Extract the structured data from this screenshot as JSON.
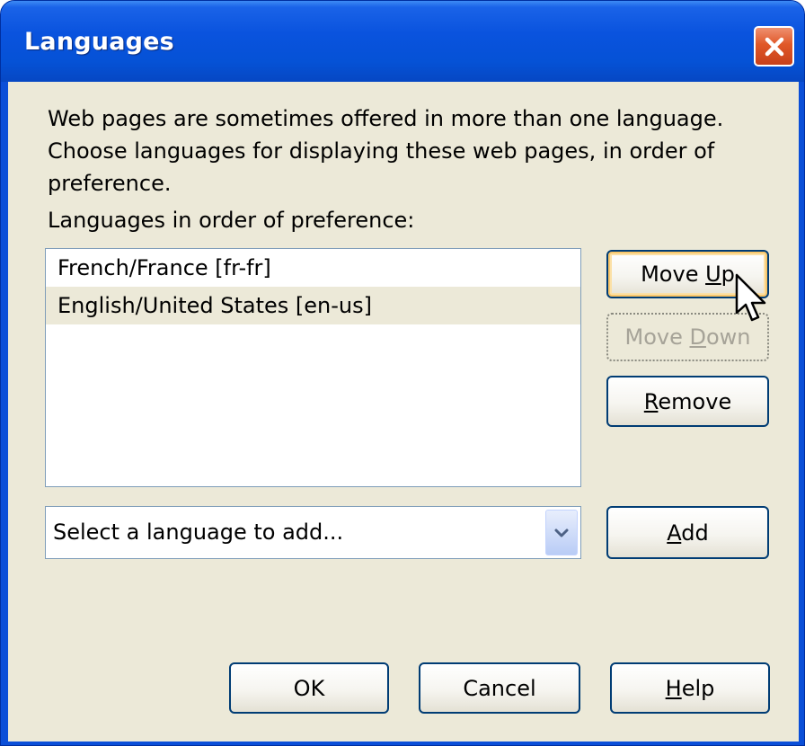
{
  "window": {
    "title": "Languages",
    "close_icon": "close-icon"
  },
  "content": {
    "description": "Web pages are sometimes offered in more than one language.\nChoose languages for displaying these web pages, in order of\npreference.",
    "list_label": "Languages in order of preference:"
  },
  "languages": [
    {
      "label": "French/France  [fr-fr]",
      "selected": false
    },
    {
      "label": "English/United States  [en-us]",
      "selected": true
    }
  ],
  "buttons": {
    "move_up": {
      "pre": "Move ",
      "mnemonic": "U",
      "post": "p"
    },
    "move_down": {
      "pre": "Move ",
      "mnemonic": "D",
      "post": "own"
    },
    "remove": {
      "pre": "",
      "mnemonic": "R",
      "post": "emove"
    },
    "add": {
      "pre": "",
      "mnemonic": "A",
      "post": "dd"
    },
    "ok": "OK",
    "cancel": "Cancel",
    "help": {
      "pre": "",
      "mnemonic": "H",
      "post": "elp"
    }
  },
  "combo": {
    "value": "Select a language to add...",
    "arrow_icon": "chevron-down-icon"
  },
  "colors": {
    "title_bar": "#0552d6",
    "dialog_bg": "#ece9d8",
    "close_button": "#e05828",
    "hot_button_highlight": "#f9c76b"
  }
}
